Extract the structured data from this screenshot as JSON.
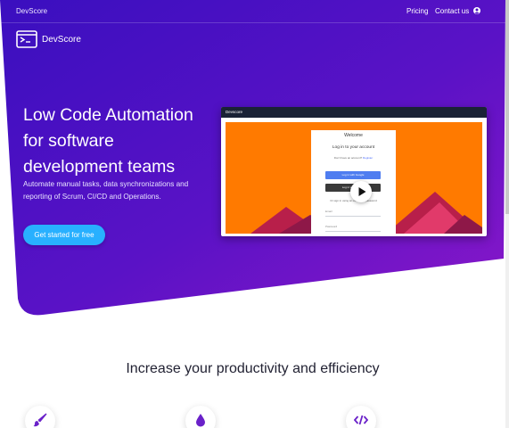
{
  "topnav": {
    "brand": "DevScore",
    "links": [
      "Pricing",
      "Contact us"
    ],
    "user_icon": "user-circle-icon"
  },
  "logo": {
    "text": "DevScore",
    "icon": "terminal-window-icon"
  },
  "hero": {
    "headline": "Low Code Automation for software development teams",
    "subtext": "Automate manual tasks, data synchronizations and reporting of Scrum, CI/CD and Operations.",
    "cta_label": "Get started for free"
  },
  "video": {
    "bar_title": "Devscore",
    "login": {
      "welcome": "Welcome",
      "title": "Log in to your account",
      "register_prefix": "Don't have an account?",
      "register_link": "Register",
      "google_button": "Log in with Google",
      "github_button": "Log in with GitHub",
      "or_text": "Or sign in using an email and password",
      "email_label": "Email",
      "password_label": "Password"
    },
    "play_icon": "play-icon"
  },
  "features": {
    "title": "Increase your productivity and efficiency",
    "icons": [
      "paintbrush-icon",
      "droplet-icon",
      "code-icon"
    ]
  },
  "colors": {
    "hero_gradient_start": "#3a0fbf",
    "hero_gradient_end": "#7b16c8",
    "cta": "#28b0ff",
    "feature_icon": "#6a21c9",
    "video_orange": "#ff7a00"
  }
}
